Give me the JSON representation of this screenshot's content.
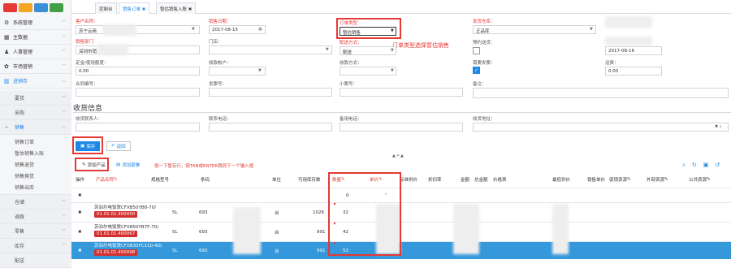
{
  "sidebar": {
    "items": [
      {
        "label": "系统管理",
        "icon": "gear-icon",
        "glyph": "⚙"
      },
      {
        "label": "主数据",
        "icon": "grid-icon",
        "glyph": "▦"
      },
      {
        "label": "人事管理",
        "icon": "user-icon",
        "glyph": "♟"
      },
      {
        "label": "市场营销",
        "icon": "handshake-icon",
        "glyph": "✿"
      },
      {
        "label": "进销存",
        "icon": "chart-icon",
        "glyph": "▥"
      }
    ],
    "sub": [
      "要货",
      "采购",
      "销售"
    ],
    "sales_sub": [
      "销售订单",
      "暂估销售入账",
      "销售退货",
      "销售换货",
      "销售出库"
    ],
    "bottom": [
      "仓储",
      "调拨",
      "零售",
      "库存",
      "配送"
    ]
  },
  "tabs": {
    "console": "控制台",
    "sales_order": "销售订单",
    "consign": "暂估销售入账"
  },
  "form": {
    "customer_label": "客户名称：",
    "customer_value": "苏宁云商",
    "date_label": "销售日期：",
    "date_value": "2017-08-15",
    "order_type_label": "订单类型",
    "order_type_value": "暂估销售",
    "warehouse_label": "发货仓库：",
    "warehouse_value": "正品库",
    "dept_label": "销售部门",
    "dept_value": "深圳市销",
    "store_label": "门店：",
    "ship_label": "配送方式：",
    "ship_value": "配送",
    "expect_label": "预约送货：",
    "expect_date": "2017-08-16",
    "deposit_label": "定金/使用额度：",
    "deposit_value": "0.00",
    "receiver_label": "收款帐户：",
    "payway_label": "收款方式：",
    "need_label": "需要发票：",
    "points_label": "运费：",
    "points_value": "0.00",
    "contract_label": "合同编号：",
    "invoice_label": "发票号：",
    "smallno_label": "小票号：",
    "remark_label": "备注："
  },
  "annotation_text": "订单类型选择暂估销售",
  "delivery": {
    "title": "收货信息",
    "contact_label": "收货联系人：",
    "phone_label": "联系电话：",
    "mobile_label": "备用电话：",
    "addr_label": "收货地址："
  },
  "buttons": {
    "save": "保存",
    "back": "返回",
    "add_product": "添加产品",
    "add_set": "添加套餐"
  },
  "grid_hint": "按一下暂存行，按TAB或ENTER跳到下一个输入框",
  "grid": {
    "headers": [
      "操作",
      "产品名称",
      "规格型号",
      "条码",
      "单位",
      "可用库存数",
      "数量",
      "单价",
      "标准供价",
      "折扣率",
      "金额",
      "总金额",
      "价格表",
      "最低供价",
      "销售单价",
      "促销资源",
      "外部资源",
      "公共资源"
    ],
    "rows": [
      {
        "name": "",
        "code": "",
        "spec": "",
        "barcode": "",
        "unit": "",
        "stock": "",
        "qty": "0"
      },
      {
        "name": "苏泊尔电饭煲CFXB50YB8-70/",
        "code": "01.01.01.400050",
        "spec": "5L",
        "barcode": "693",
        "unit": "台",
        "stock": "1026",
        "qty": "32"
      },
      {
        "name": "苏泊尔电饭煲CFXB50YB7F-70/",
        "code": "01.01.01.400067",
        "spec": "5L",
        "barcode": "693",
        "unit": "台",
        "stock": "991",
        "qty": "42"
      },
      {
        "name": "苏泊尔电饭煲CFXB30FC11D-60/",
        "code": "01.01.01.400098",
        "spec": "5L",
        "barcode": "693",
        "unit": "台",
        "stock": "991",
        "qty": "52"
      }
    ]
  }
}
